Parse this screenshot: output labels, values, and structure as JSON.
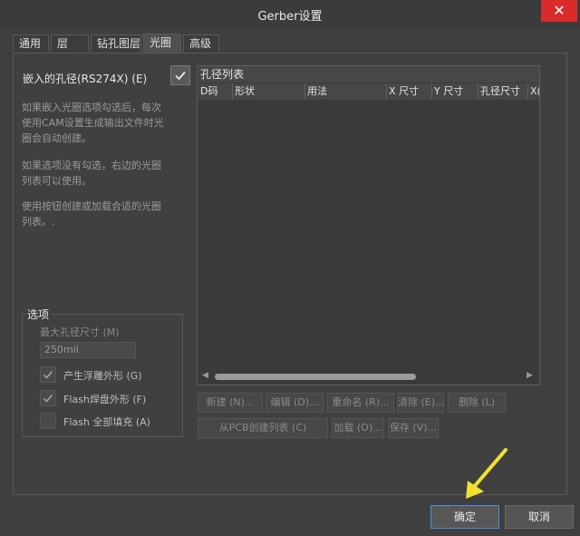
{
  "window": {
    "title": "Gerber设置",
    "close_icon": "close-icon"
  },
  "tabs": [
    {
      "label": "通用"
    },
    {
      "label": "层"
    },
    {
      "label": "钻孔图层"
    },
    {
      "label": "光圈",
      "active": true
    },
    {
      "label": "高级"
    }
  ],
  "left": {
    "embed_label": "嵌入的孔径(RS274X) (E)",
    "embed_checked": true,
    "desc1": [
      "如果嵌入光圈选项勾选后，每次",
      "使用CAM设置生成输出文件时光",
      "圈会自动创建。"
    ],
    "desc2": [
      "如果选项没有勾选，右边的光圈",
      "列表可以使用。"
    ],
    "desc3": [
      "使用按钮创建或加载合适的光圈",
      "列表。."
    ]
  },
  "options": {
    "title": "选项",
    "max_aperture_label": "最大孔径尺寸 (M)",
    "max_aperture_value": "250mil",
    "items": [
      {
        "label": "产生浮雕外形 (G)",
        "checked": true
      },
      {
        "label": "Flash焊盘外形 (F)",
        "checked": true
      },
      {
        "label": "Flash 全部填充 (A)",
        "checked": false
      }
    ]
  },
  "list": {
    "title": "孔径列表",
    "columns": [
      "D码",
      "形状",
      "用法",
      "X 尺寸",
      "Y 尺寸",
      "孔径尺寸",
      "X("
    ]
  },
  "buttons": {
    "new": "新建 (N)...",
    "edit": "编辑 (D)...",
    "rename": "重命名 (R)...",
    "clear": "清除 (E)...",
    "delete": "删除 (L)",
    "create_from_pcb": "从PCB创建列表 (C)",
    "load": "加载 (O)...",
    "save": "保存 (V)..."
  },
  "footer": {
    "ok": "确定",
    "cancel": "取消"
  },
  "colors": {
    "accent": "#4a90e2",
    "close": "#d92b2b",
    "annotation": "#f2e230"
  }
}
